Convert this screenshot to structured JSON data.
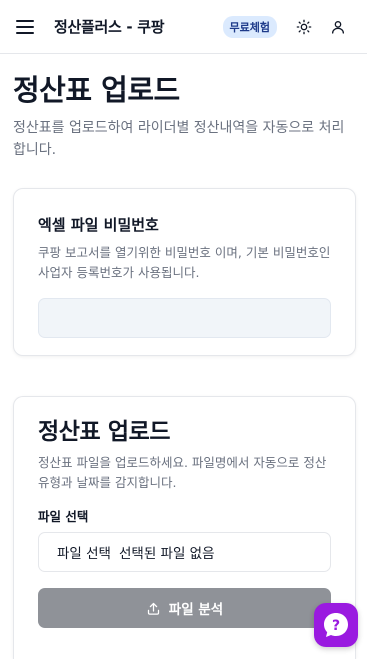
{
  "header": {
    "title": "정산플러스 - 쿠팡",
    "badge": "무료체험",
    "icons": [
      "menu-icon",
      "sun-icon",
      "user-icon"
    ]
  },
  "page": {
    "title": "정산표 업로드",
    "description": "정산표를 업로드하여 라이더별 정산내역을 자동으로 처리합니다."
  },
  "password_card": {
    "heading": "엑셀 파일 비밀번호",
    "description": "쿠팡 보고서를 열기위한 비밀번호 이며, 기본 비밀번호인 사업자 등록번호가 사용됩니다.",
    "input_value": "",
    "input_placeholder": ""
  },
  "upload_card": {
    "title": "정산표 업로드",
    "description": "정산표 파일을 업로드하세요. 파일명에서 자동으로 정산 유형과 날짜를 감지합니다.",
    "file_label": "파일 선택",
    "file_button": "파일 선택",
    "file_status": "선택된 파일 없음",
    "analyze_button": "파일 분석"
  },
  "help": {
    "icon": "help-icon"
  },
  "colors": {
    "accent": "#9a1ae0",
    "badge_bg": "#dbeafe",
    "button_disabled": "#8f9298"
  }
}
